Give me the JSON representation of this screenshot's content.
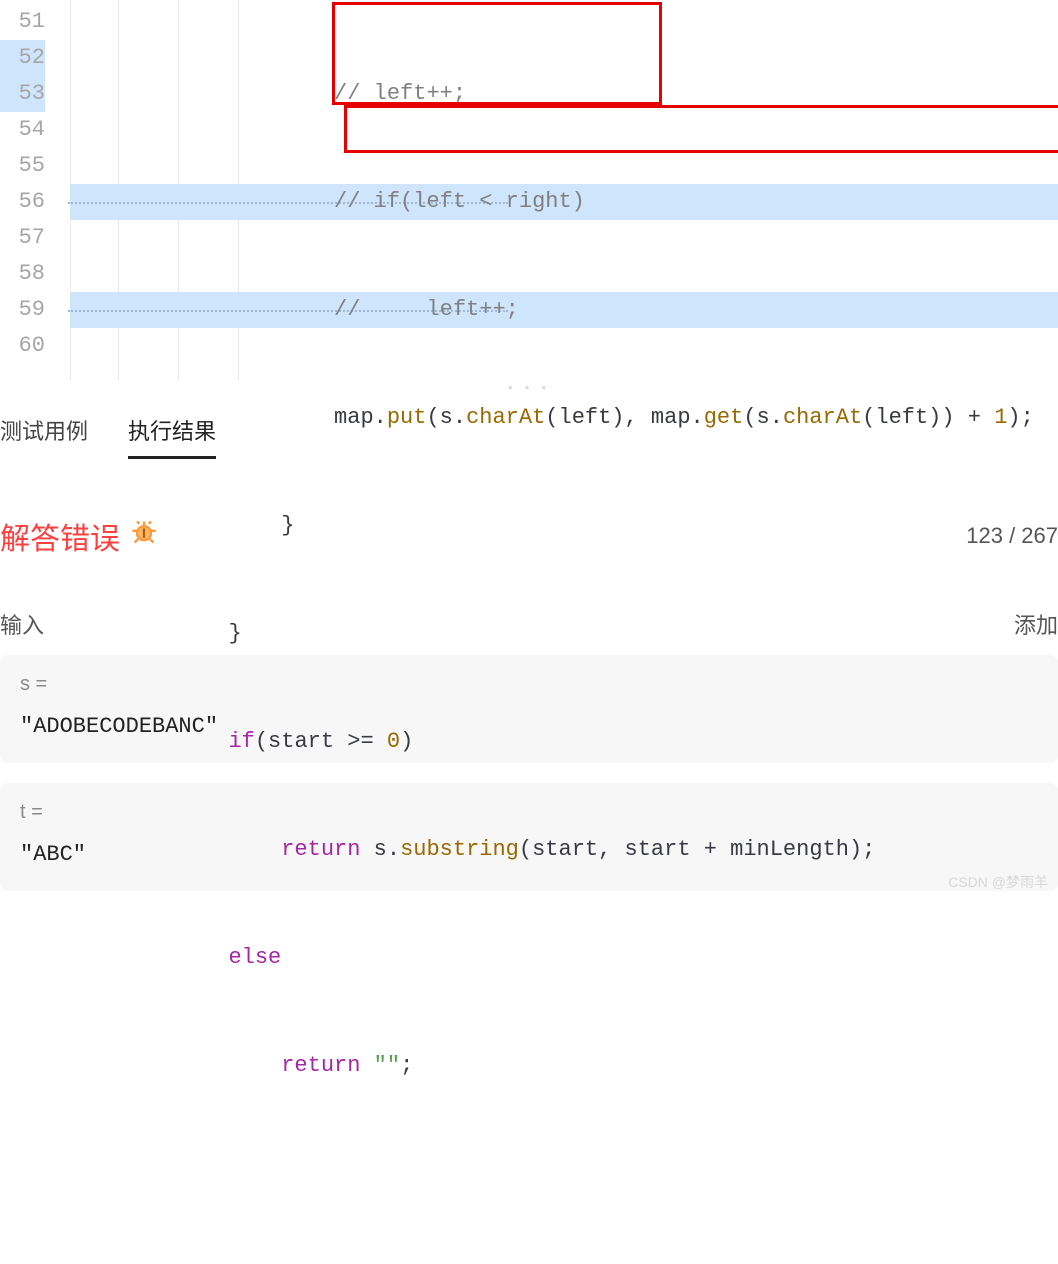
{
  "editor": {
    "lines": [
      {
        "n": "51",
        "indent": "                    ",
        "raw": "// left++;",
        "cls": "tk-comment",
        "sel": false
      },
      {
        "n": "52",
        "indent": "                    ",
        "raw": "// if(left < right)",
        "cls": "tk-comment",
        "sel": true
      },
      {
        "n": "53",
        "indent": "                    ",
        "raw": "//     left++;",
        "cls": "tk-comment",
        "sel": true
      },
      {
        "n": "54",
        "indent": "                    ",
        "raw": "",
        "cls": "",
        "sel": false
      },
      {
        "n": "55",
        "indent": "                ",
        "raw": "}",
        "cls": "tk-plain",
        "sel": false
      },
      {
        "n": "56",
        "indent": "            ",
        "raw": "}",
        "cls": "tk-plain",
        "sel": false
      },
      {
        "n": "57",
        "indent": "            ",
        "raw": "",
        "cls": "",
        "sel": false
      },
      {
        "n": "58",
        "indent": "                ",
        "raw": "",
        "cls": "",
        "sel": false
      },
      {
        "n": "59",
        "indent": "            ",
        "raw": "else",
        "cls": "tk-keyword",
        "sel": false
      },
      {
        "n": "60",
        "indent": "                ",
        "raw": "",
        "cls": "",
        "sel": false
      }
    ],
    "line54": {
      "p1": "map.",
      "m1": "put",
      "p2": "(s.",
      "m2": "charAt",
      "p3": "(left), map.",
      "m3": "get",
      "p4": "(s.",
      "m4": "charAt",
      "p5": "(left)) + ",
      "num": "1",
      "p6": ");"
    },
    "line57": {
      "kw": "if",
      "rest": "(start >= ",
      "num": "0",
      "tail": ")"
    },
    "line58": {
      "kw": "return",
      "mid": " s.",
      "m1": "substring",
      "rest": "(start, start + minLength);"
    },
    "line60": {
      "kw": "return",
      "sp": " ",
      "str": "\"\"",
      "tail": ";"
    }
  },
  "tabs": {
    "cases": "测试用例",
    "result": "执行结果"
  },
  "result": {
    "status": "解答错误",
    "stats": "123 / 267"
  },
  "input": {
    "label": "输入",
    "add": "添加",
    "s_label": "s =",
    "s_value": "\"ADOBECODEBANC\"",
    "t_label": "t =",
    "t_value": "\"ABC\""
  },
  "watermark": "CSDN @梦雨羊",
  "drag": "• • •"
}
